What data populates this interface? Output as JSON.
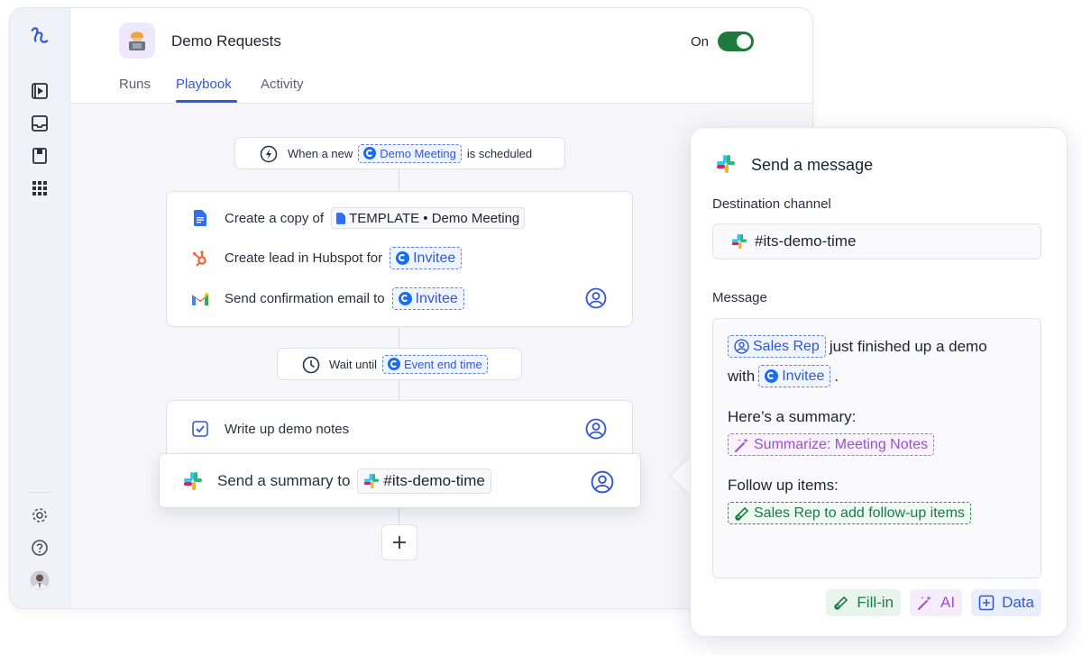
{
  "header": {
    "title": "Demo Requests",
    "toggle_label": "On",
    "tabs": [
      {
        "label": "Runs"
      },
      {
        "label": "Playbook"
      },
      {
        "label": "Activity"
      }
    ]
  },
  "trigger": {
    "prefix": "When a new",
    "chip": "Demo Meeting",
    "suffix": "is scheduled"
  },
  "steps": {
    "copy": {
      "label": "Create a copy of",
      "chip": "TEMPLATE • Demo Meeting"
    },
    "lead": {
      "label": "Create lead in Hubspot for",
      "chip": "Invitee"
    },
    "email": {
      "label": "Send confirmation email to",
      "chip": "Invitee"
    }
  },
  "wait": {
    "label": "Wait until",
    "chip": "Event end time"
  },
  "tasks": {
    "notes": {
      "label": "Write up demo notes"
    },
    "summary": {
      "label": "Send a summary to",
      "chip": "#its-demo-time"
    }
  },
  "panel": {
    "title": "Send a message",
    "channel_label": "Destination channel",
    "channel_value": "#its-demo-time",
    "message_label": "Message",
    "message": {
      "chip_rep": "Sales Rep",
      "text1": "just finished up a demo",
      "with": "with",
      "chip_invitee": "Invitee",
      "period": ".",
      "summary_heading": "Here’s a summary:",
      "chip_summarize": "Summarize: Meeting Notes",
      "followup_heading": "Follow up items:",
      "chip_followup": "Sales Rep to add follow-up items"
    },
    "actions": {
      "fill_in": "Fill-in",
      "ai": "AI",
      "data": "Data"
    }
  },
  "colors": {
    "accent": "#3358d4",
    "toggle_on": "#1f7a3e",
    "ai_purple": "#9c4fd0",
    "fill_green": "#1b7a45"
  },
  "icons": [
    "logo-icon",
    "play-icon",
    "inbox-icon",
    "book-icon",
    "grid-icon",
    "settings-icon",
    "help-icon",
    "avatar",
    "bolt-icon",
    "google-doc-icon",
    "hubspot-icon",
    "gmail-icon",
    "person-icon",
    "clock-icon",
    "checkbox-icon",
    "slack-icon",
    "plus-icon",
    "wand-icon",
    "pencil-icon",
    "add-box-icon"
  ]
}
